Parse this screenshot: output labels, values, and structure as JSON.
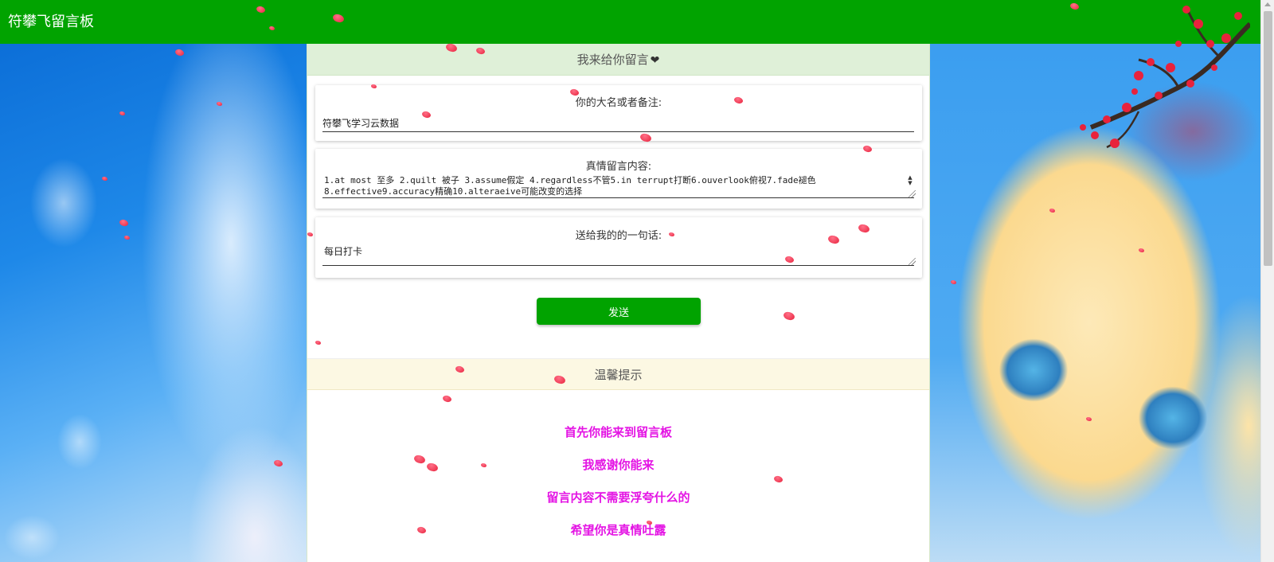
{
  "navbar": {
    "brand": "符攀飞留言板"
  },
  "form": {
    "heading": "我来给你留言",
    "heading_icon": "heart-icon",
    "name": {
      "label": "你的大名或者备注:",
      "value": "符攀飞学习云数据"
    },
    "message": {
      "label": "真情留言内容:",
      "value": "1.at most 至多 2.quilt 被子 3.assume假定 4.regardless不管5.in terrupt打断6.ouverlook俯视7.fade褪色\n8.effective9.accuracy精确10.alteraeive可能改变的选择"
    },
    "phrase": {
      "label": "送给我的的一句话:",
      "value": "每日打卡"
    },
    "send_label": "发送"
  },
  "tips": {
    "heading": "温馨提示",
    "lines": [
      "首先你能来到留言板",
      "我感谢你能来",
      "留言内容不需要浮夸什么的",
      "希望你是真情吐露"
    ]
  },
  "colors": {
    "navbar": "#01a300",
    "button": "#01a300",
    "form_heading_bg": "#dff0d8",
    "tips_heading_bg": "#fcf8e3",
    "tip_text": "#e414e4"
  }
}
